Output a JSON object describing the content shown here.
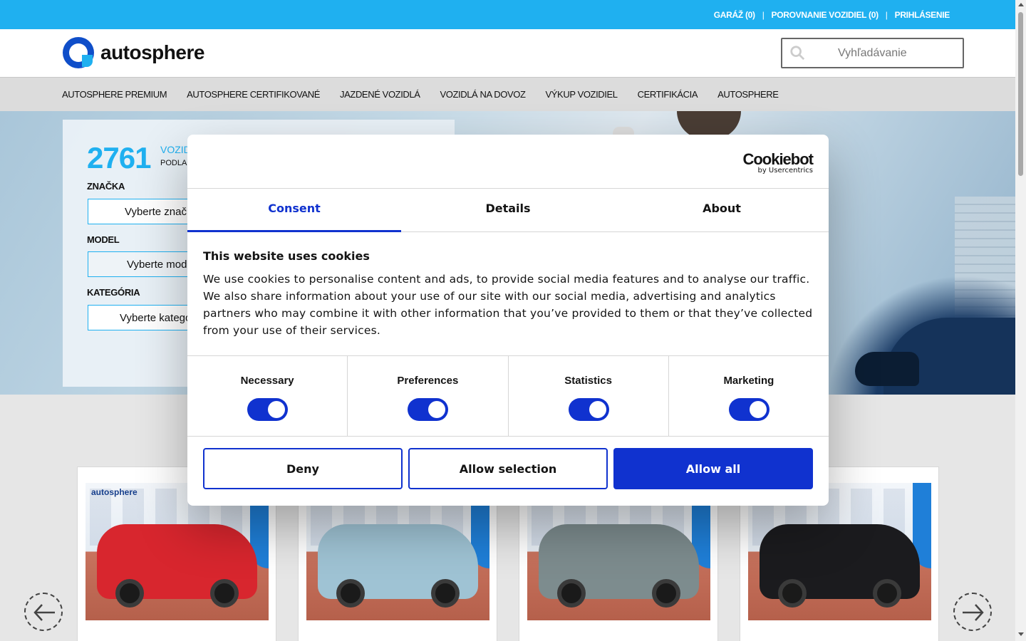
{
  "topbar": {
    "garage": "GARÁŽ (0)",
    "compare": "POROVNANIE VOZIDIEL (0)",
    "login": "PRIHLÁSENIE",
    "separator": "|"
  },
  "header": {
    "logo_text": "autosphere",
    "search_placeholder": "Vyhľadávanie"
  },
  "nav": {
    "items": [
      "AUTOSPHERE PREMIUM",
      "AUTOSPHERE CERTIFIKOVANÉ",
      "JAZDENÉ VOZIDLÁ",
      "VOZIDLÁ NA DOVOZ",
      "VÝKUP VOZIDIEL",
      "CERTIFIKÁCIA",
      "AUTOSPHERE"
    ]
  },
  "filter": {
    "count": "2761",
    "count_label": "VOZID",
    "count_sub": "PODLA",
    "brand_label": "ZNAČKA",
    "brand_select": "Vyberte značk",
    "model_label": "MODEL",
    "model_select": "Vyberte mode",
    "category_label": "KATEGÓRIA",
    "category_select": "Vyberte kategó"
  },
  "cards": [
    {
      "brand_tag": "autosphere",
      "color": "#d8262e"
    },
    {
      "brand_tag": "",
      "color": "#9fc3d4"
    },
    {
      "brand_tag": "",
      "color": "#7d8c8e"
    },
    {
      "brand_tag": "",
      "color": "#1b1b1e"
    }
  ],
  "cookie": {
    "logo": "Cookiebot",
    "logo_sub": "by Usercentrics",
    "tabs": [
      "Consent",
      "Details",
      "About"
    ],
    "title": "This website uses cookies",
    "body": "We use cookies to personalise content and ads, to provide social media features and to analyse our traffic. We also share information about your use of our site with our social media, advertising and analytics partners who may combine it with other information that you’ve provided to them or that they’ve collected from your use of their services.",
    "toggles": [
      "Necessary",
      "Preferences",
      "Statistics",
      "Marketing"
    ],
    "buttons": {
      "deny": "Deny",
      "allow_selection": "Allow selection",
      "allow_all": "Allow all"
    },
    "accent": "#1032cf"
  },
  "colors": {
    "brand_cyan": "#1fb0f0",
    "brand_blue": "#0f4ec9"
  }
}
